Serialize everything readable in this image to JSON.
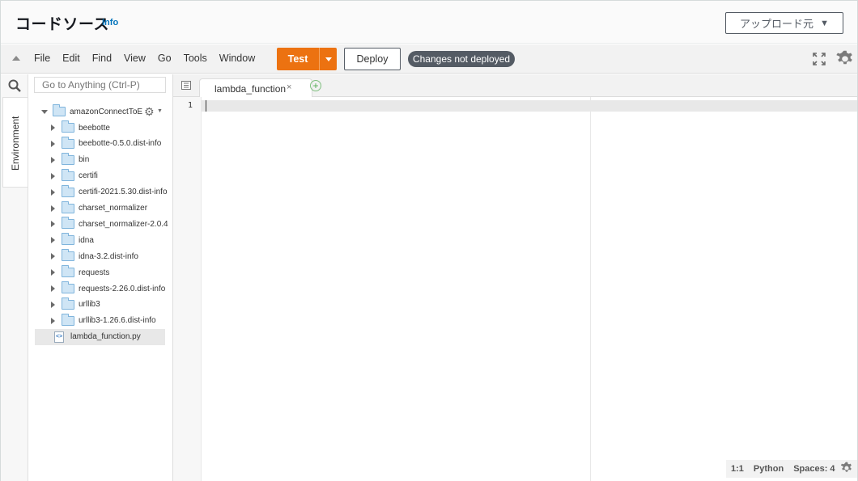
{
  "header": {
    "title": "コードソース",
    "info_link": "Info",
    "upload_button": "アップロード元"
  },
  "menubar": {
    "items": [
      "File",
      "Edit",
      "Find",
      "View",
      "Go",
      "Tools",
      "Window"
    ],
    "test_button": "Test",
    "deploy_button": "Deploy",
    "status_badge": "Changes not deployed"
  },
  "sidebar": {
    "environment_tab": "Environment",
    "goto_placeholder": "Go to Anything (Ctrl-P)"
  },
  "tree": {
    "root": "amazonConnectToE",
    "items": [
      {
        "label": "beebotte",
        "type": "folder"
      },
      {
        "label": "beebotte-0.5.0.dist-info",
        "type": "folder"
      },
      {
        "label": "bin",
        "type": "folder"
      },
      {
        "label": "certifi",
        "type": "folder"
      },
      {
        "label": "certifi-2021.5.30.dist-info",
        "type": "folder"
      },
      {
        "label": "charset_normalizer",
        "type": "folder"
      },
      {
        "label": "charset_normalizer-2.0.4",
        "type": "folder"
      },
      {
        "label": "idna",
        "type": "folder"
      },
      {
        "label": "idna-3.2.dist-info",
        "type": "folder"
      },
      {
        "label": "requests",
        "type": "folder"
      },
      {
        "label": "requests-2.26.0.dist-info",
        "type": "folder"
      },
      {
        "label": "urllib3",
        "type": "folder"
      },
      {
        "label": "urllib3-1.26.6.dist-info",
        "type": "folder"
      },
      {
        "label": "lambda_function.py",
        "type": "file",
        "selected": true
      }
    ]
  },
  "editor": {
    "tab_label": "lambda_function",
    "tab_close": "×",
    "line_numbers": [
      "1"
    ]
  },
  "statusbar": {
    "position": "1:1",
    "language": "Python",
    "indent": "Spaces: 4"
  },
  "icons": {
    "collapse": "collapse-arrow-icon",
    "fullscreen": "fullscreen-icon",
    "settings": "gear-icon",
    "search": "search-icon",
    "folder": "folder-icon",
    "file": "python-file-icon",
    "add_tab": "add-tab-icon"
  },
  "colors": {
    "accent": "#ec7211",
    "link": "#0073bb",
    "badge": "#545b64"
  }
}
